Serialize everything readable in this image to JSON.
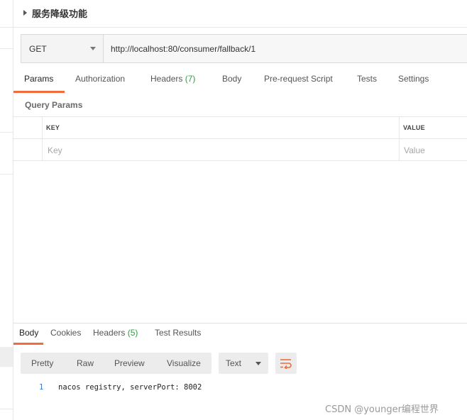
{
  "request": {
    "title": "服务降级功能",
    "method": "GET",
    "url": "http://localhost:80/consumer/fallback/1"
  },
  "request_tabs": [
    {
      "label": "Params",
      "count": "",
      "active": true
    },
    {
      "label": "Authorization",
      "count": "",
      "active": false
    },
    {
      "label": "Headers",
      "count": "(7)",
      "active": false
    },
    {
      "label": "Body",
      "count": "",
      "active": false
    },
    {
      "label": "Pre-request Script",
      "count": "",
      "active": false
    },
    {
      "label": "Tests",
      "count": "",
      "active": false
    },
    {
      "label": "Settings",
      "count": "",
      "active": false
    }
  ],
  "query_params": {
    "section_label": "Query Params",
    "columns": {
      "key": "KEY",
      "value": "VALUE"
    },
    "placeholders": {
      "key": "Key",
      "value": "Value"
    }
  },
  "response_tabs": [
    {
      "label": "Body",
      "count": "",
      "active": true
    },
    {
      "label": "Cookies",
      "count": "",
      "active": false
    },
    {
      "label": "Headers",
      "count": "(5)",
      "active": false
    },
    {
      "label": "Test Results",
      "count": "",
      "active": false
    }
  ],
  "view_modes": [
    "Pretty",
    "Raw",
    "Preview",
    "Visualize"
  ],
  "format": {
    "selected": "Text"
  },
  "response_body": {
    "lines": [
      {
        "number": "1",
        "text": "nacos registry, serverPort: 8002"
      }
    ]
  },
  "watermark": "CSDN @younger编程世界",
  "icons": {
    "title_toggle": "caret-right-icon",
    "method_dropdown": "chevron-down-icon",
    "format_dropdown": "chevron-down-icon",
    "wrap": "wrap-lines-icon"
  },
  "colors": {
    "accent": "#f26b3a",
    "count": "#2e9e46",
    "line_number": "#2d7dd2"
  }
}
